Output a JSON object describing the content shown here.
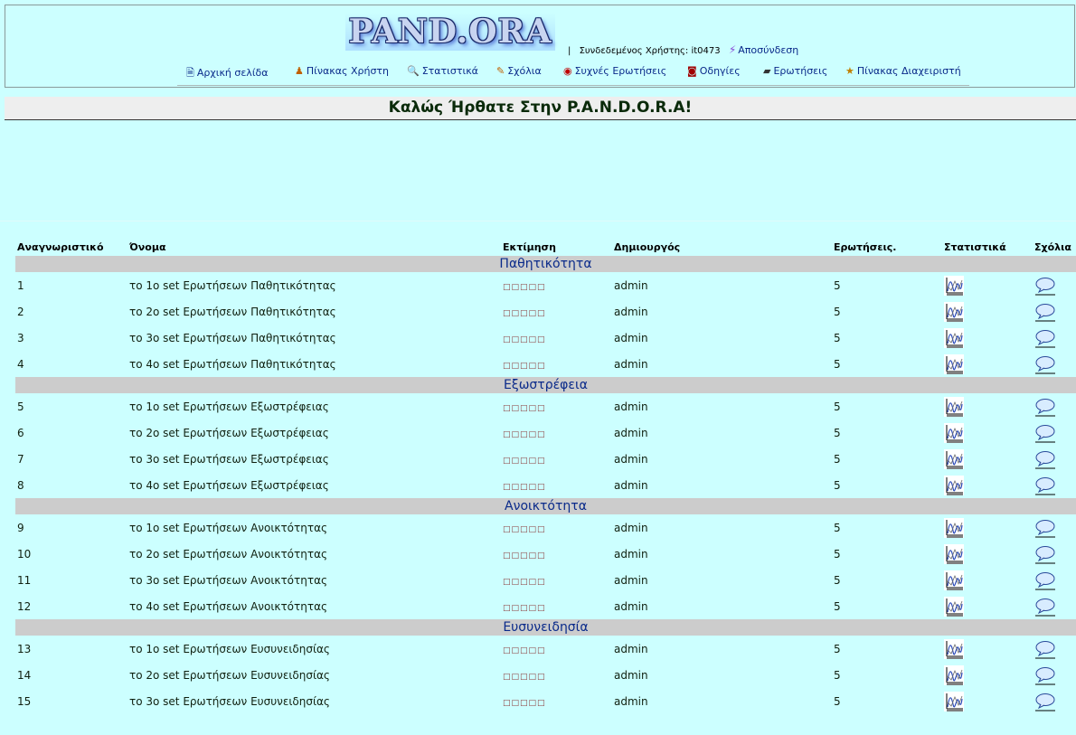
{
  "header": {
    "logo_text": "PAND.ORA",
    "separator": "|",
    "user_label": "Συνδεδεμένος Χρήστης:",
    "username": "it0473",
    "logout_label": "Αποσύνδεση"
  },
  "nav": {
    "items": [
      {
        "label": "Αρχική σελίδα",
        "icon": "home-icon"
      },
      {
        "label": "Πίνακας Χρήστη",
        "icon": "user-icon"
      },
      {
        "label": "Στατιστικά",
        "icon": "statistics-icon"
      },
      {
        "label": "Σχόλια",
        "icon": "comments-icon"
      },
      {
        "label": "Συχνές Ερωτήσεις",
        "icon": "faq-icon"
      },
      {
        "label": "Οδηγίες",
        "icon": "instructions-icon"
      },
      {
        "label": "Ερωτήσεις",
        "icon": "questions-icon"
      },
      {
        "label": "Πίνακας Διαχειριστή",
        "icon": "admin-icon"
      }
    ]
  },
  "welcome": {
    "title": "Καλώς Ήρθατε Στην P.A.N.D.O.R.A!"
  },
  "table": {
    "headers": {
      "id": "Αναγνωριστικό",
      "name": "Όνομα",
      "rating": "Εκτίμηση",
      "creator": "Δημιουργός",
      "questions": "Ερωτήσεις.",
      "stats": "Στατιστικά",
      "comments": "Σχόλια"
    },
    "groups": [
      {
        "title": "Παθητικότητα",
        "rows": [
          {
            "id": "1",
            "name": "το 1ο set Ερωτήσεων Παθητικότητας",
            "rating": "□□□□□",
            "creator": "admin",
            "questions": "5"
          },
          {
            "id": "2",
            "name": "το 2ο set Ερωτήσεων Παθητικότητας",
            "rating": "□□□□□",
            "creator": "admin",
            "questions": "5"
          },
          {
            "id": "3",
            "name": "το 3ο set Ερωτήσεων Παθητικότητας",
            "rating": "□□□□□",
            "creator": "admin",
            "questions": "5"
          },
          {
            "id": "4",
            "name": "το 4ο set Ερωτήσεων Παθητικότητας",
            "rating": "□□□□□",
            "creator": "admin",
            "questions": "5"
          }
        ]
      },
      {
        "title": "Εξωστρέφεια",
        "rows": [
          {
            "id": "5",
            "name": "το 1ο set Ερωτήσεων Εξωστρέφειας",
            "rating": "□□□□□",
            "creator": "admin",
            "questions": "5"
          },
          {
            "id": "6",
            "name": "το 2ο set Ερωτήσεων Εξωστρέφειας",
            "rating": "□□□□□",
            "creator": "admin",
            "questions": "5"
          },
          {
            "id": "7",
            "name": "το 3ο set Ερωτήσεων Εξωστρέφειας",
            "rating": "□□□□□",
            "creator": "admin",
            "questions": "5"
          },
          {
            "id": "8",
            "name": "το 4ο set Ερωτήσεων Εξωστρέφειας",
            "rating": "□□□□□",
            "creator": "admin",
            "questions": "5"
          }
        ]
      },
      {
        "title": "Ανοικτότητα",
        "rows": [
          {
            "id": "9",
            "name": "το 1ο set Ερωτήσεων Ανοικτότητας",
            "rating": "□□□□□",
            "creator": "admin",
            "questions": "5"
          },
          {
            "id": "10",
            "name": "το 2ο set Ερωτήσεων Ανοικτότητας",
            "rating": "□□□□□",
            "creator": "admin",
            "questions": "5"
          },
          {
            "id": "11",
            "name": "το 3ο set Ερωτήσεων Ανοικτότητας",
            "rating": "□□□□□",
            "creator": "admin",
            "questions": "5"
          },
          {
            "id": "12",
            "name": "το 4ο set Ερωτήσεων Ανοικτότητας",
            "rating": "□□□□□",
            "creator": "admin",
            "questions": "5"
          }
        ]
      },
      {
        "title": "Ευσυνειδησία",
        "rows": [
          {
            "id": "13",
            "name": "το 1ο set Ερωτήσεων Ευσυνειδησίας",
            "rating": "□□□□□",
            "creator": "admin",
            "questions": "5"
          },
          {
            "id": "14",
            "name": "το 2ο set Ερωτήσεων Ευσυνειδησίας",
            "rating": "□□□□□",
            "creator": "admin",
            "questions": "5"
          },
          {
            "id": "15",
            "name": "το 3ο set Ερωτήσεων Ευσυνειδησίας",
            "rating": "□□□□□",
            "creator": "admin",
            "questions": "5"
          }
        ]
      }
    ]
  }
}
